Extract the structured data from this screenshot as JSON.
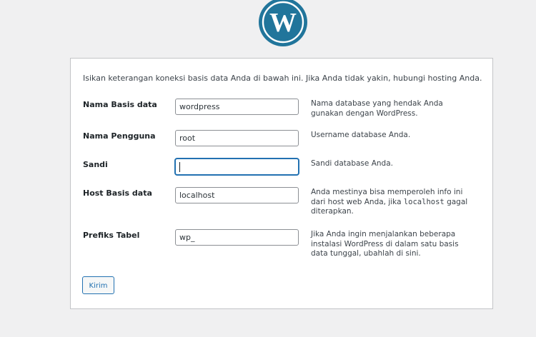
{
  "colors": {
    "accent": "#2271b1",
    "logo": "#21759b",
    "background": "#f0f0f1",
    "card": "#ffffff"
  },
  "logo": {
    "icon": "wordpress-logo-icon"
  },
  "intro": "Isikan keterangan koneksi basis data Anda di bawah ini. Jika Anda tidak yakin, hubungi hosting Anda.",
  "fields": {
    "dbname": {
      "label": "Nama Basis data",
      "value": "wordpress",
      "help": "Nama database yang hendak Anda gunakan dengan WordPress."
    },
    "username": {
      "label": "Nama Pengguna",
      "value": "root",
      "help": "Username database Anda."
    },
    "password": {
      "label": "Sandi",
      "value": "",
      "help": "Sandi database Anda."
    },
    "host": {
      "label": "Host Basis data",
      "value": "localhost",
      "help_pre": "Anda mestinya bisa memperoleh info ini dari host web Anda, jika ",
      "help_code": "localhost",
      "help_post": " gagal diterapkan."
    },
    "prefix": {
      "label": "Prefiks Tabel",
      "value": "wp_",
      "help": "Jika Anda ingin menjalankan beberapa instalasi WordPress di dalam satu basis data tunggal, ubahlah di sini."
    }
  },
  "submit_label": "Kirim"
}
